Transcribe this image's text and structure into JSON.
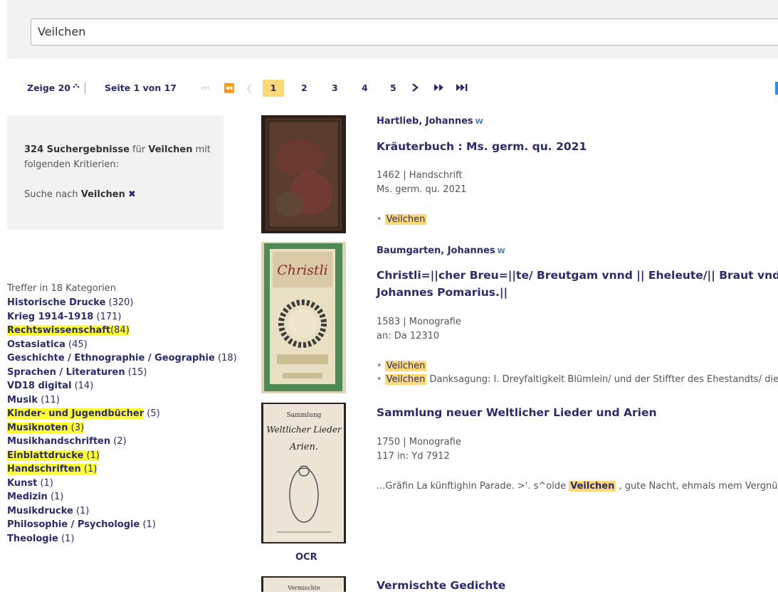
{
  "search": {
    "value": "Veilchen"
  },
  "pager": {
    "show_label": "Zeige 20",
    "page_info": "Seite 1 von 17",
    "pages": [
      "1",
      "2",
      "3",
      "4",
      "5"
    ],
    "current": "1"
  },
  "criteria": {
    "count": "324 Suchergebnisse",
    "for_word": "für",
    "query": "Veilchen",
    "with_word": "mit",
    "line2": "folgenden Kritierien:",
    "search_label": "Suche nach",
    "search_term": "Veilchen"
  },
  "categories": {
    "heading": "Treffer in 18 Kategorien",
    "items": [
      {
        "name": "Historische Drucke",
        "count": "(320)"
      },
      {
        "name": "Krieg 1914-1918",
        "count": "(171)"
      },
      {
        "name": "Rechtswissenschaft",
        "count": "(84)"
      },
      {
        "name": "Ostasiatica",
        "count": "(45)"
      },
      {
        "name": "Geschichte / Ethnographie / Geographie",
        "count": "(18)"
      },
      {
        "name": "Sprachen / Literaturen",
        "count": "(15)"
      },
      {
        "name": "VD18 digital",
        "count": "(14)"
      },
      {
        "name": "Musik",
        "count": "(11)"
      },
      {
        "name": "Kinder- und Jugendbücher",
        "count": "(5)"
      },
      {
        "name": "Musiknoten",
        "count": "(3)"
      },
      {
        "name": "Musikhandschriften",
        "count": "(2)"
      },
      {
        "name": "Einblattdrucke",
        "count": "(1)"
      },
      {
        "name": "Handschriften",
        "count": "(1)"
      },
      {
        "name": "Kunst",
        "count": "(1)"
      },
      {
        "name": "Medizin",
        "count": "(1)"
      },
      {
        "name": "Musikdrucke",
        "count": "(1)"
      },
      {
        "name": "Philosophie / Psychologie",
        "count": "(1)"
      },
      {
        "name": "Theologie",
        "count": "(1)"
      }
    ]
  },
  "results": [
    {
      "author": "Hartlieb, Johannes",
      "title": "Kräuterbuch : Ms. germ. qu. 2021",
      "meta1": "1462 | Handschrift",
      "meta2": "Ms. germ. qu. 2021",
      "hit": "Veilchen"
    },
    {
      "author": "Baumgarten, Johannes",
      "title1": "Christli=||cher Breu=||te/ Breutgam vnnd || Eheleute/|| Braut vnd |",
      "title2": "Johannes Pomarius.||",
      "meta1": "1583 | Monografie",
      "meta2": "an: Da 12310",
      "hit1": "Veilchen",
      "hit2": "Veilchen",
      "hit2_rest": "Danksagung: I. Dreyfaltigkeit Blümlein/ und der Stiffter des Ehestandts/ die"
    },
    {
      "title": "Sammlung neuer Weltlicher Lieder und Arien",
      "meta1": "1750 | Monografie",
      "meta2": "117 in: Yd 7912",
      "snip_pre": "...Gräfin La künftighin Parade. >'. s^olde",
      "snip_hit": "Veilchen",
      "snip_post": ", gute Nacht, ehmals mem Vergnüge",
      "ocr_label": "OCR"
    },
    {
      "title": "Vermischte Gedichte"
    }
  ],
  "icons": {
    "wiki": "w-icon",
    "remove": "x-icon"
  },
  "colors": {
    "highlight": "#fdd97a",
    "category_highlight": "#ffff33",
    "link": "#2b2b6b"
  }
}
